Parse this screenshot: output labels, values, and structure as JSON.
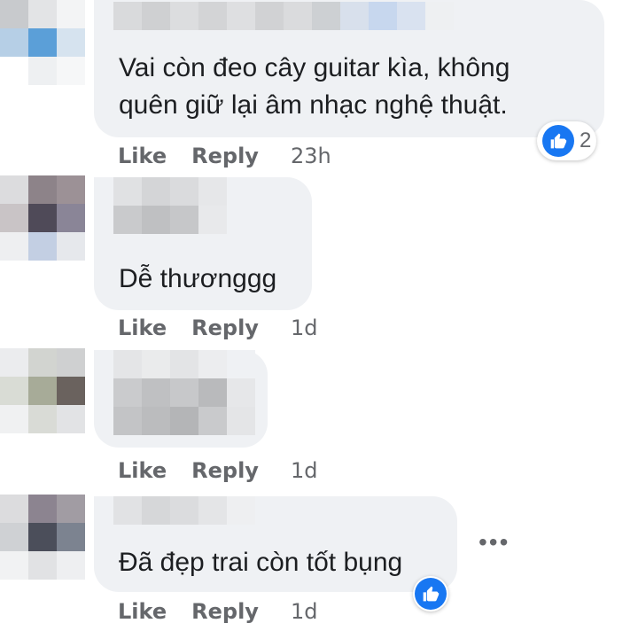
{
  "labels": {
    "like": "Like",
    "reply": "Reply",
    "more": "•••"
  },
  "comments": [
    {
      "text_lines": [
        "Vai còn đeo cây guitar kìa, không",
        "quên giữ lại âm nhạc nghệ thuật."
      ],
      "time": "23h",
      "reaction_count": "2"
    },
    {
      "text_lines": [
        "Dễ thươnggg"
      ],
      "time": "1d"
    },
    {
      "text_lines": [],
      "time": "1d"
    },
    {
      "text_lines": [
        "Đã đẹp trai còn tốt bụng"
      ],
      "time": "1d"
    }
  ],
  "colors": {
    "bubble": "#eff1f4",
    "meta": "#65676b",
    "like_blue": "#1877f2"
  }
}
